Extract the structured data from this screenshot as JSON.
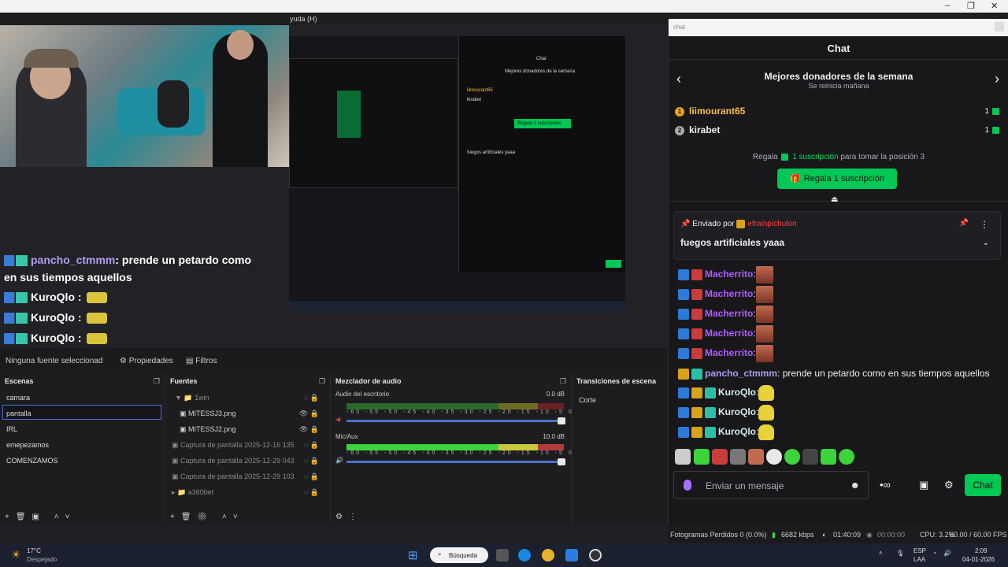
{
  "window": {
    "menu_partial": "yuda (H)",
    "controls": [
      "–",
      "❐",
      "✕"
    ]
  },
  "overlay_chat": {
    "line1_user": "pancho_ctmmm",
    "line1_text": ": prende un petardo como",
    "line2_text": "en sus tiempos aquellos",
    "kuro": "KuroQlo :"
  },
  "nested": {
    "chat_title": "Chat",
    "donors_title": "Mejores donadores de la semana",
    "donor1": "liimourant65",
    "donor2": "kirabet",
    "gift_btn": "Regala 1 suscripción",
    "pinned": "fuegos artificiales yaaa",
    "send": "Chat"
  },
  "source_bar": {
    "no_source": "Ninguna fuente seleccionad",
    "properties": "Propiedades",
    "filters": "Filtros"
  },
  "scenes": {
    "title": "Escenas",
    "items": [
      "camara",
      "pantalla",
      "IRL",
      "emepezamos",
      "COMENZAMOS"
    ]
  },
  "sources": {
    "title": "Fuentes",
    "items": [
      "1win",
      "MITESSJ3.png",
      "MITESSJ2.png",
      "Captura de pantalla 2025-12-16 135",
      "Captura de pantalla 2025-12-29 043",
      "Captura de pantalla 2025-12-29 103",
      "a360bet"
    ]
  },
  "mixer": {
    "title": "Mezclador de audio",
    "ch1_name": "Audio del escritorio",
    "ch1_db": "0.0 dB",
    "ch2_name": "Mic/Aux",
    "ch2_db": "10.0 dB",
    "scale": "-60 -55 -50 -45 -40 -35 -30 -25 -20 -15 -10 -5 0"
  },
  "transitions": {
    "title": "Transiciones de escena",
    "value": "Corte"
  },
  "status": {
    "dropped": "Fotogramas Perdidos 0 (0.0%)",
    "kbps": "6682 kbps",
    "stream_time": "01:40:09",
    "rec_time": "00:00:00",
    "cpu": "CPU: 3.2%",
    "fps": "60.00 / 60.00 FPS"
  },
  "chat": {
    "url": "chat",
    "header": "Chat",
    "donors_title": "Mejores donadores de la semana",
    "donors_sub": "Se reinicia mañana",
    "donors": [
      {
        "rank": "1",
        "name": "liimourant65",
        "count": "1"
      },
      {
        "rank": "2",
        "name": "kirabet",
        "count": "1"
      }
    ],
    "gift_prefix": "Regala",
    "gift_highlight": "1 suscripción",
    "gift_suffix": "para tomar la posición 3",
    "gift_button": "Regala 1 suscripción",
    "pinned_by_label": "Enviado por",
    "pinned_by_user": "efrainpichulon",
    "pinned_text": "fuegos artificiales yaaa",
    "messages": [
      {
        "user": "Macherrito",
        "text": ":",
        "color": "#b05cff",
        "emote": "face"
      },
      {
        "user": "Macherrito",
        "text": ":",
        "color": "#b05cff",
        "emote": "face"
      },
      {
        "user": "Macherrito",
        "text": ":",
        "color": "#b05cff",
        "emote": "face"
      },
      {
        "user": "Macherrito",
        "text": ":",
        "color": "#b05cff",
        "emote": "face"
      },
      {
        "user": "Macherrito",
        "text": ":",
        "color": "#b05cff",
        "emote": "face"
      },
      {
        "user": "pancho_ctmmm",
        "text": ": prende un petardo como en sus tiempos aquellos",
        "color": "#b19cf0",
        "emote": ""
      },
      {
        "user": "KuroQlo",
        "text": ":",
        "color": "#d9e8e8",
        "emote": "pika"
      },
      {
        "user": "KuroQlo",
        "text": ":",
        "color": "#d9e8e8",
        "emote": "pika"
      },
      {
        "user": "KuroQlo",
        "text": ":",
        "color": "#d9e8e8",
        "emote": "pika"
      }
    ],
    "input_placeholder": "Enviar un mensaje",
    "send_label": "Chat"
  },
  "taskbar": {
    "weather_temp": "17°C",
    "weather_desc": "Despejado",
    "search": "Búsqueda",
    "lang1": "ESP",
    "lang2": "LAA",
    "time": "2:09",
    "date": "04-01-2026"
  },
  "colors": {
    "twitch_green": "#00c755",
    "obs_bg": "#1d1d20",
    "chat_bg": "#18181b",
    "accent_blue": "#4a6fd0"
  }
}
